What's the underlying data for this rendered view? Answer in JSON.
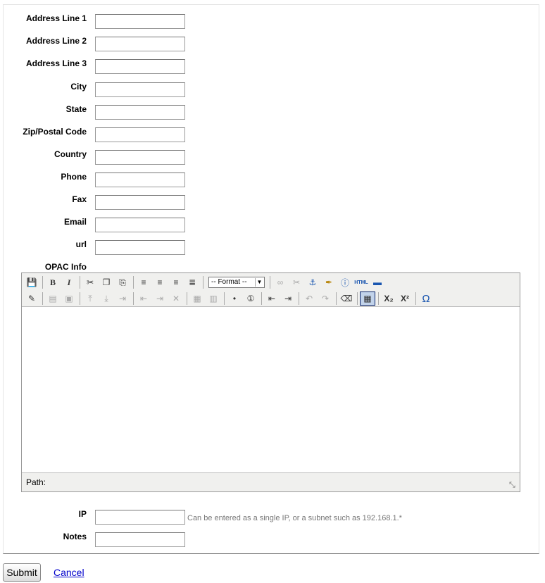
{
  "fields": [
    {
      "label": "Address Line 1",
      "value": ""
    },
    {
      "label": "Address Line 2",
      "value": ""
    },
    {
      "label": "Address Line 3",
      "value": ""
    },
    {
      "label": "City",
      "value": ""
    },
    {
      "label": "State",
      "value": ""
    },
    {
      "label": "Zip/Postal Code",
      "value": ""
    },
    {
      "label": "Country",
      "value": ""
    },
    {
      "label": "Phone",
      "value": ""
    },
    {
      "label": "Fax",
      "value": ""
    },
    {
      "label": "Email",
      "value": ""
    },
    {
      "label": "url",
      "value": ""
    }
  ],
  "opac": {
    "label": "OPAC Info",
    "format_select": "-- Format --",
    "html_button": "HTML",
    "path_label": "Path:",
    "toolbar_icons": [
      "save-icon",
      "bold-icon",
      "italic-icon",
      "cut-icon",
      "copy-icon",
      "paste-icon",
      "align-left-icon",
      "align-center-icon",
      "align-right-icon",
      "align-justify-icon",
      "link-icon",
      "unlink-icon",
      "anchor-icon",
      "cleanup-icon",
      "help-icon",
      "html-icon",
      "hr-icon",
      "edit-icon",
      "table-icon",
      "list-bullets-icon",
      "list-numbers-icon",
      "outdent-icon",
      "indent-icon",
      "undo-icon",
      "redo-icon",
      "eraser-icon",
      "visual-aid-icon",
      "subscript-icon",
      "superscript-icon",
      "omega-icon"
    ]
  },
  "ip": {
    "label": "IP",
    "value": "",
    "hint": "Can be entered as a single IP, or a subnet such as 192.168.1.*"
  },
  "notes": {
    "label": "Notes",
    "value": ""
  },
  "actions": {
    "submit": "Submit",
    "cancel": "Cancel"
  },
  "colors": {
    "link": "#0000cc",
    "hint": "#777777",
    "active_button": "#c2d3ea"
  }
}
